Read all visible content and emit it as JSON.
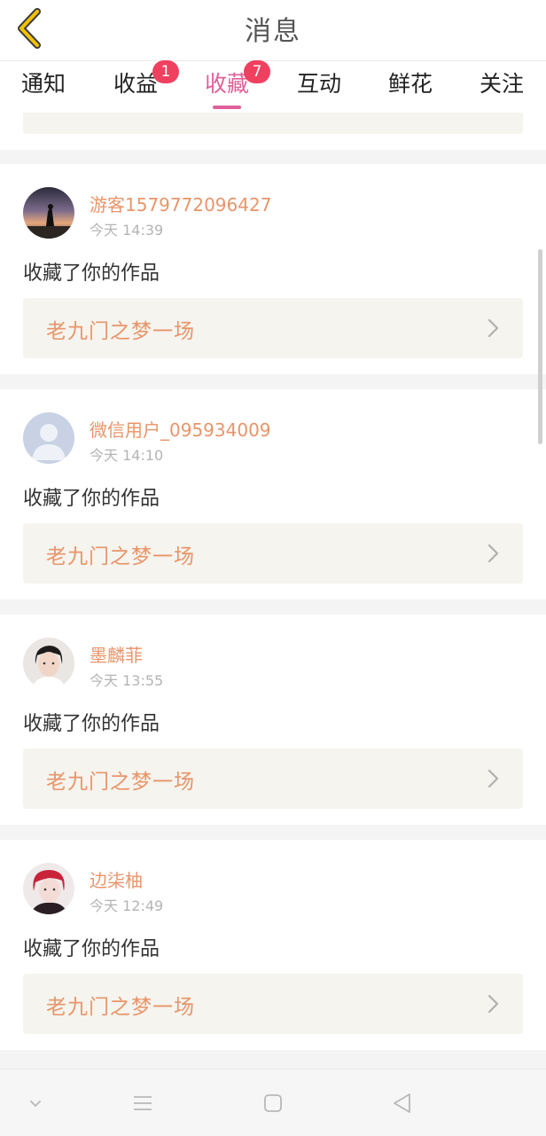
{
  "header": {
    "title": "消息",
    "back_icon": "chevron-left-icon"
  },
  "tabs": [
    {
      "label": "通知",
      "badge": null,
      "active": false
    },
    {
      "label": "收益",
      "badge": "1",
      "active": false
    },
    {
      "label": "收藏",
      "badge": "7",
      "active": true
    },
    {
      "label": "互动",
      "badge": null,
      "active": false
    },
    {
      "label": "鲜花",
      "badge": null,
      "active": false
    },
    {
      "label": "关注",
      "badge": null,
      "active": false
    }
  ],
  "colors": {
    "accent": "#e0609a",
    "badge": "#f04060",
    "name": "#e8956a",
    "work_bg": "#f5f4ee"
  },
  "messages": [
    {
      "user": "游客1579772096427",
      "time": "今天 14:39",
      "action": "收藏了你的作品",
      "work": "老九门之梦一场",
      "avatar": "sunset-silhouette-avatar"
    },
    {
      "user": "微信用户_095934009",
      "time": "今天 14:10",
      "action": "收藏了你的作品",
      "work": "老九门之梦一场",
      "avatar": "default-user-avatar"
    },
    {
      "user": "墨麟菲",
      "time": "今天 13:55",
      "action": "收藏了你的作品",
      "work": "老九门之梦一场",
      "avatar": "portrait-avatar"
    },
    {
      "user": "边柒柚",
      "time": "今天 12:49",
      "action": "收藏了你的作品",
      "work": "老九门之梦一场",
      "avatar": "red-hair-portrait-avatar"
    }
  ],
  "system_nav": [
    "chevron-down-icon",
    "menu-icon",
    "home-square-icon",
    "back-triangle-icon"
  ]
}
